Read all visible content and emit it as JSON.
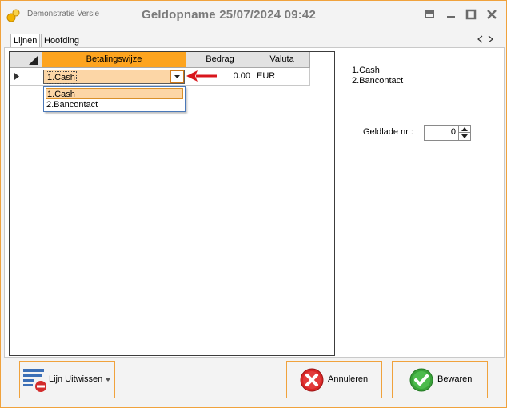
{
  "window": {
    "demo_label": "Demonstratie Versie",
    "title": "Geldopname 25/07/2024 09:42"
  },
  "tabs": [
    {
      "label": "Lijnen",
      "active": true
    },
    {
      "label": "Hoofding",
      "active": false
    }
  ],
  "grid": {
    "headers": [
      "Betalingswijze",
      "Bedrag",
      "Valuta"
    ],
    "selected_header": "Betalingswijze",
    "rows": [
      {
        "betalingswijze": "1.Cash",
        "bedrag": "0.00",
        "valuta": "EUR"
      }
    ]
  },
  "dropdown": {
    "options": [
      "1.Cash",
      "2.Bancontact"
    ],
    "selected": "1.Cash"
  },
  "side_list": [
    "1.Cash",
    "2.Bancontact"
  ],
  "geldlade": {
    "label": "Geldlade nr :",
    "value": "0"
  },
  "buttons": {
    "lijn_uitwissen": "Lijn Uitwissen",
    "annuleren": "Annuleren",
    "bewaren": "Bewaren"
  },
  "colors": {
    "accent": "#f0a23c",
    "header_selected": "#fda41f",
    "selection": "#fcd6a6",
    "arrow": "#d9161c"
  }
}
